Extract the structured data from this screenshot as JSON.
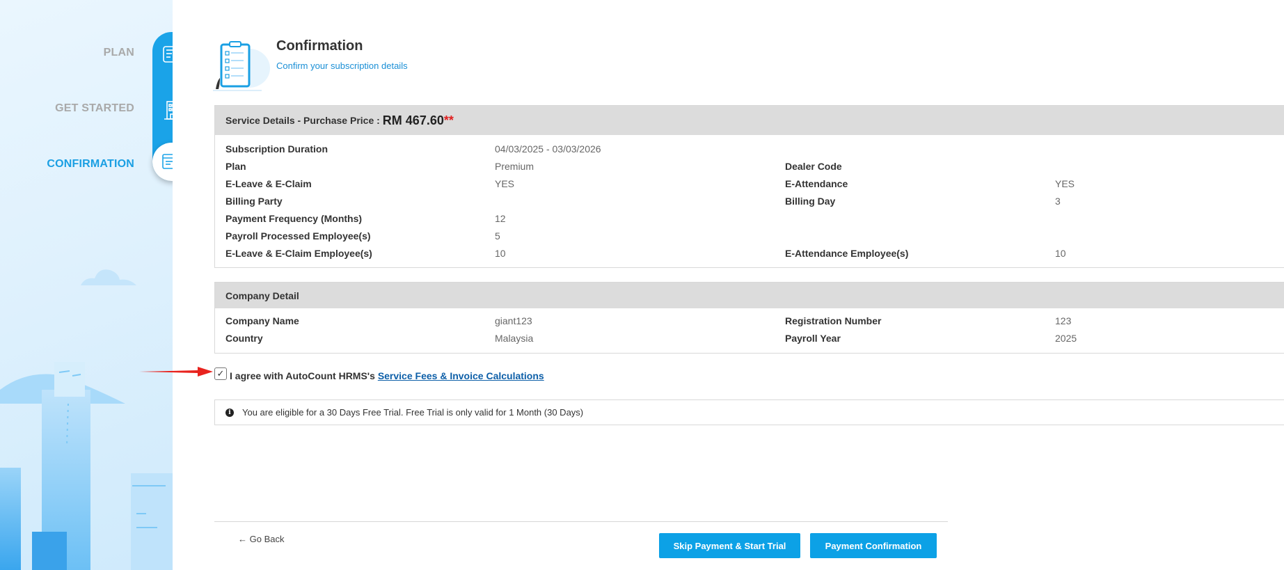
{
  "sidebar": {
    "steps": [
      {
        "label": "PLAN",
        "icon": "edit-document-icon",
        "state": "completed"
      },
      {
        "label": "GET STARTED",
        "icon": "building-icon",
        "state": "completed"
      },
      {
        "label": "CONFIRMATION",
        "icon": "confirm-document-icon",
        "state": "active"
      }
    ]
  },
  "header": {
    "title": "Confirmation",
    "subtitle": "Confirm your subscription details"
  },
  "service": {
    "heading": "Service Details - Purchase Price :",
    "price": "RM 467.60",
    "price_mark": "**",
    "rows": {
      "duration": {
        "label": "Subscription Duration",
        "value": "04/03/2025 - 03/03/2026"
      },
      "plan": {
        "label": "Plan",
        "value": "Premium"
      },
      "dealer": {
        "label": "Dealer Code",
        "value": ""
      },
      "eleave": {
        "label": "E-Leave & E-Claim",
        "value": "YES"
      },
      "eattendance": {
        "label": "E-Attendance",
        "value": "YES"
      },
      "billing_party": {
        "label": "Billing Party",
        "value": ""
      },
      "billing_day": {
        "label": "Billing Day",
        "value": "3"
      },
      "frequency": {
        "label": "Payment Frequency (Months)",
        "value": "12"
      },
      "payroll_employees": {
        "label": "Payroll Processed Employee(s)",
        "value": "5"
      },
      "eleave_employees": {
        "label": "E-Leave & E-Claim Employee(s)",
        "value": "10"
      },
      "eattendance_employees": {
        "label": "E-Attendance Employee(s)",
        "value": "10"
      }
    }
  },
  "company": {
    "heading": "Company Detail",
    "rows": {
      "name": {
        "label": "Company Name",
        "value": "giant123"
      },
      "registration": {
        "label": "Registration Number",
        "value": "123"
      },
      "country": {
        "label": "Country",
        "value": "Malaysia"
      },
      "payroll_year": {
        "label": "Payroll Year",
        "value": "2025"
      }
    }
  },
  "agreement": {
    "checked": true,
    "text": "I agree with AutoCount HRMS's",
    "link": "Service Fees & Invoice Calculations"
  },
  "notice": {
    "text": "You are eligible for a 30 Days Free Trial. Free Trial is only valid for 1 Month (30 Days)"
  },
  "footer": {
    "back_label": "← Go Back",
    "skip_label": "Skip Payment & Start Trial",
    "pay_label": "Payment Confirmation"
  },
  "colors": {
    "accent": "#0ca1e6",
    "step_track": "#1aa3e8",
    "link": "#0d5fa8",
    "price_mark": "#e02020"
  }
}
